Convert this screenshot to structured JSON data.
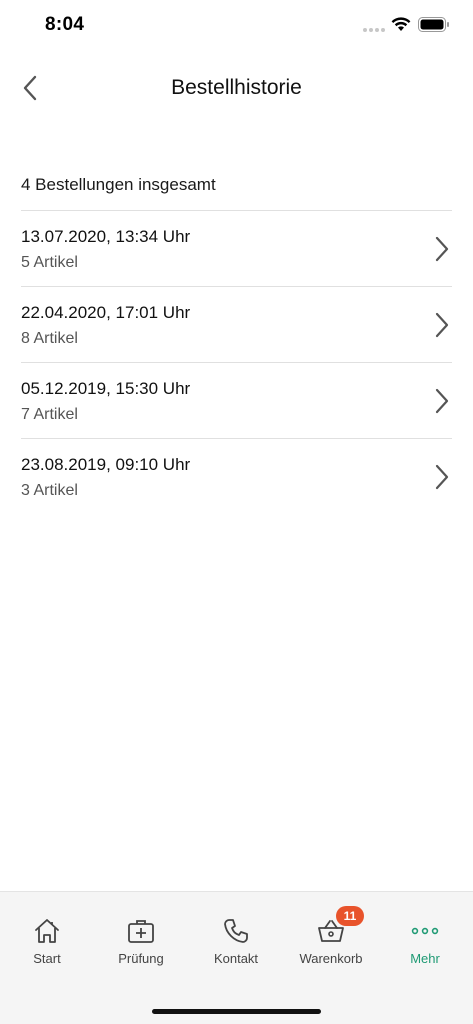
{
  "status_bar": {
    "time": "8:04"
  },
  "nav": {
    "title": "Bestellhistorie"
  },
  "summary": "4 Bestellungen insgesamt",
  "orders": [
    {
      "date": "13.07.2020, 13:34 Uhr",
      "items": "5 Artikel"
    },
    {
      "date": "22.04.2020, 17:01 Uhr",
      "items": "8 Artikel"
    },
    {
      "date": "05.12.2019, 15:30 Uhr",
      "items": "7 Artikel"
    },
    {
      "date": "23.08.2019, 09:10 Uhr",
      "items": "3 Artikel"
    }
  ],
  "tab_bar": {
    "tabs": [
      {
        "label": "Start",
        "icon": "home-icon"
      },
      {
        "label": "Prüfung",
        "icon": "medical-kit-icon"
      },
      {
        "label": "Kontakt",
        "icon": "phone-icon"
      },
      {
        "label": "Warenkorb",
        "icon": "basket-icon",
        "badge": "11"
      },
      {
        "label": "Mehr",
        "icon": "more-dots-icon",
        "active": true
      }
    ]
  },
  "colors": {
    "accent": "#1f9a74",
    "badge": "#e8532b",
    "tab_bar_bg": "#f5f5f5"
  }
}
